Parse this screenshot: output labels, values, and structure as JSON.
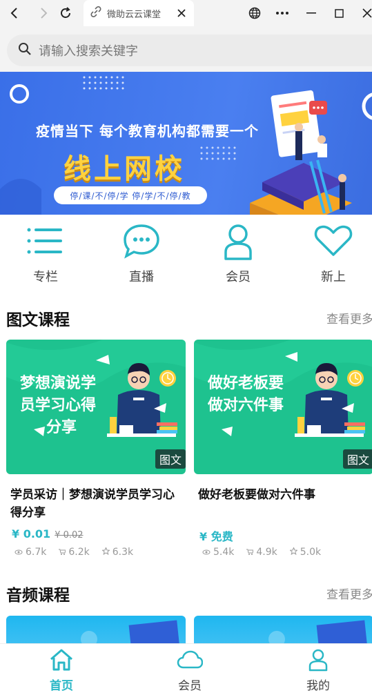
{
  "browser": {
    "tab_title": "微助云云课堂",
    "icons": [
      "back-icon",
      "forward-icon",
      "reload-icon",
      "link-icon",
      "close-icon",
      "globe-icon",
      "more-icon",
      "minimize-icon",
      "maximize-icon",
      "window-close-icon"
    ]
  },
  "search": {
    "placeholder": "请输入搜索关键字"
  },
  "banner": {
    "line1": "疫情当下 每个教育机构都需要一个",
    "line2": "线上网校",
    "tagline": "停/课/不/停/学   停/学/不/停/教"
  },
  "quick_nav": [
    {
      "label": "专栏",
      "icon": "list-icon"
    },
    {
      "label": "直播",
      "icon": "chat-bubble-icon"
    },
    {
      "label": "会员",
      "icon": "member-icon"
    },
    {
      "label": "新上",
      "icon": "heart-icon"
    }
  ],
  "sections": {
    "graphic": {
      "title": "图文课程",
      "more": "查看更多"
    },
    "audio": {
      "title": "音频课程",
      "more": "查看更多"
    }
  },
  "courses": [
    {
      "cover_title_1": "梦想演说学",
      "cover_title_2": "员学习心得",
      "cover_title_3": "分享",
      "tag": "图文",
      "title": "学员采访｜梦想演说学员学习心得分享",
      "price": "¥ 0.01",
      "old_price": "¥ 0.02",
      "views": "6.7k",
      "buys": "6.2k",
      "stars": "6.3k"
    },
    {
      "cover_title_1": "做好老板要",
      "cover_title_2": "做对六件事",
      "cover_title_3": "",
      "tag": "图文",
      "title": "做好老板要做对六件事",
      "price": "¥ 免费",
      "old_price": "",
      "views": "5.4k",
      "buys": "4.9k",
      "stars": "5.0k"
    }
  ],
  "bottom_nav": [
    {
      "label": "首页",
      "icon": "home-icon",
      "active": true
    },
    {
      "label": "会员",
      "icon": "cloud-icon",
      "active": false
    },
    {
      "label": "我的",
      "icon": "person-icon",
      "active": false
    }
  ],
  "colors": {
    "accent": "#2ab7c6",
    "banner": "#3a6fe8",
    "card": "#1ec28f",
    "highlight": "#ffd23f"
  }
}
